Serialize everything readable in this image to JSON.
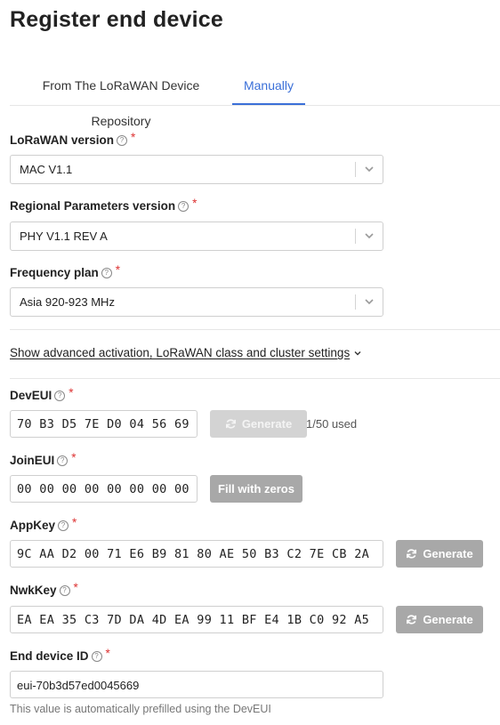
{
  "page": {
    "title": "Register end device"
  },
  "tabs": [
    {
      "label": "From The LoRaWAN Device Repository",
      "active": false
    },
    {
      "label": "Manually",
      "active": true
    }
  ],
  "fields": {
    "lorawan_version": {
      "label": "LoRaWAN version",
      "value": "MAC V1.1"
    },
    "regional_params": {
      "label": "Regional Parameters version",
      "value": "PHY V1.1 REV A"
    },
    "frequency_plan": {
      "label": "Frequency plan",
      "value": "Asia 920-923 MHz"
    }
  },
  "advanced_link": "Show advanced activation, LoRaWAN class and cluster settings",
  "dev_eui": {
    "label": "DevEUI",
    "value": "70 B3 D5 7E D0 04 56 69",
    "button": "Generate",
    "usage": "1/50 used"
  },
  "join_eui": {
    "label": "JoinEUI",
    "value": "00 00 00 00 00 00 00 00",
    "button": "Fill with zeros"
  },
  "app_key": {
    "label": "AppKey",
    "value": "9C AA D2 00 71 E6 B9 81 80 AE 50 B3 C2 7E CB 2A",
    "button": "Generate"
  },
  "nwk_key": {
    "label": "NwkKey",
    "value": "EA EA 35 C3 7D DA 4D EA 99 11 BF E4 1B C0 92 A5",
    "button": "Generate"
  },
  "end_device_id": {
    "label": "End device ID",
    "value": "eui-70b3d57ed0045669",
    "hint": "This value is automatically prefilled using the DevEUI"
  },
  "required_mark": "*",
  "colors": {
    "accent": "#3a6fd8",
    "required": "#dd3333",
    "button_gray": "#a8a8a8",
    "button_disabled": "#d3d3d3"
  }
}
